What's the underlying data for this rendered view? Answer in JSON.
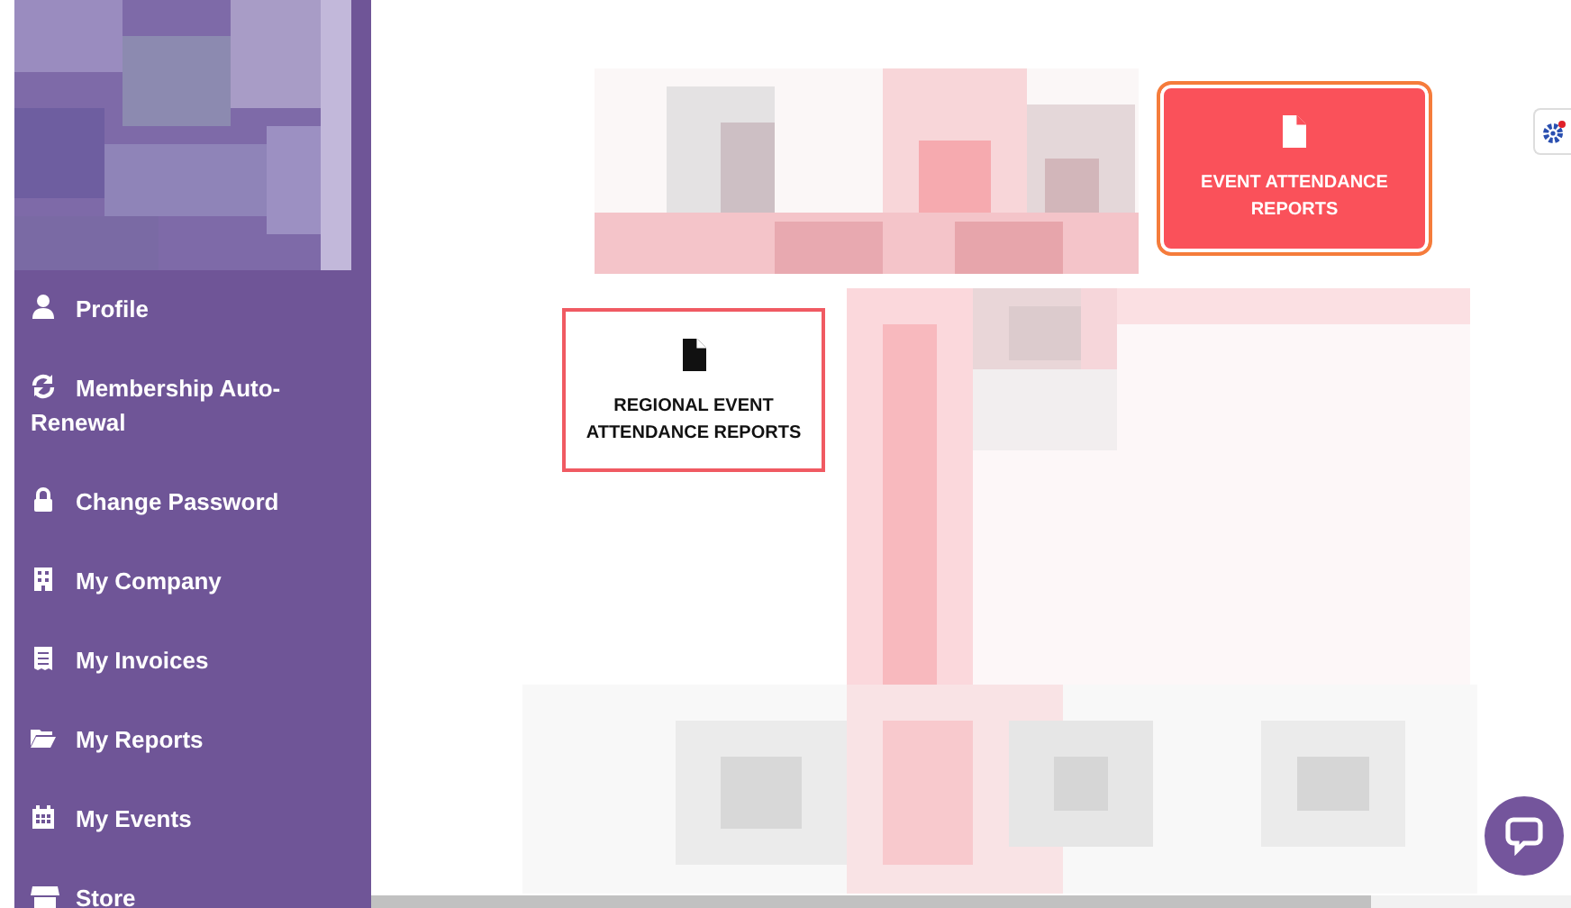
{
  "sidebar": {
    "items": [
      {
        "label": "Profile"
      },
      {
        "label": "Membership Auto-Renewal"
      },
      {
        "label": "Change Password"
      },
      {
        "label": "My Company"
      },
      {
        "label": "My Invoices"
      },
      {
        "label": "My Reports"
      },
      {
        "label": "My Events"
      },
      {
        "label": "Store"
      }
    ]
  },
  "cards": [
    {
      "label": "EVENT ATTENDANCE REPORTS",
      "selected": true
    },
    {
      "label": "REGIONAL EVENT ATTENDANCE REPORTS",
      "selected": false
    }
  ]
}
